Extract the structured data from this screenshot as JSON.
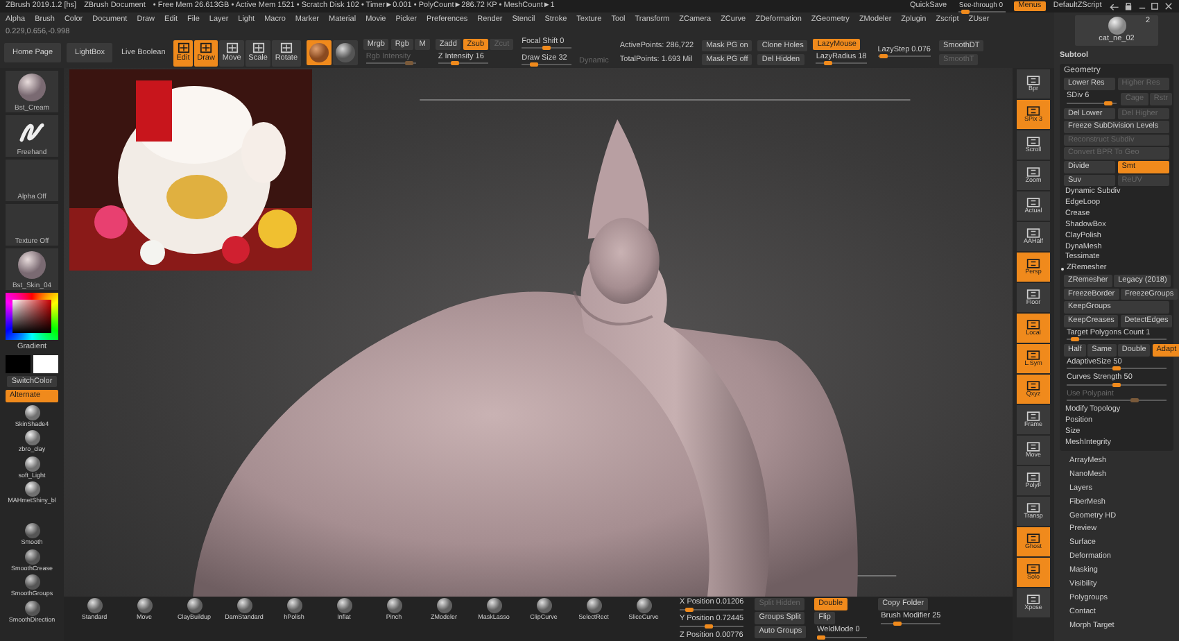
{
  "title_bar": {
    "app": "ZBrush 2019.1.2 [hs]",
    "document": "ZBrush Document",
    "stats": "• Free Mem 26.613GB • Active Mem 1521 • Scratch Disk 102 • Timer►0.001 • PolyCount►286.72 KP • MeshCount►1",
    "items": [
      {
        "kind": "text",
        "label": "QuickSave"
      },
      {
        "kind": "slider",
        "label": "See-through  0",
        "level": 0.05
      },
      {
        "kind": "toggle",
        "label": "Menus",
        "selected": true
      },
      {
        "kind": "text",
        "label": "DefaultZScript"
      }
    ]
  },
  "menu_bar": [
    "Alpha",
    "Brush",
    "Color",
    "Document",
    "Draw",
    "Edit",
    "File",
    "Layer",
    "Light",
    "Macro",
    "Marker",
    "Material",
    "Movie",
    "Picker",
    "Preferences",
    "Render",
    "Stencil",
    "Stroke",
    "Texture",
    "Tool",
    "Transform",
    "ZCamera",
    "ZCurve",
    "ZDeformation",
    "ZGeometry",
    "ZModeler",
    "Zplugin",
    "Zscript",
    "ZUser"
  ],
  "coordinates": "0.229,0.656,-0.998",
  "toolbar": [
    {
      "rows": [
        [
          {
            "kind": "button",
            "label": "Home Page"
          }
        ]
      ]
    },
    {
      "rows": [
        [
          {
            "kind": "button",
            "label": "LightBox"
          }
        ]
      ]
    },
    {
      "rows": [
        [
          {
            "kind": "text",
            "label": "Live Boolean"
          }
        ]
      ]
    },
    {
      "rows": [
        [
          {
            "kind": "icon-button",
            "label": "Edit",
            "selected": true
          },
          {
            "kind": "icon-button",
            "label": "Draw",
            "selected": true
          },
          {
            "kind": "icon-button",
            "label": "Move",
            "selected": false
          },
          {
            "kind": "icon-button",
            "label": "Scale",
            "selected": false
          },
          {
            "kind": "icon-button",
            "label": "Rotate",
            "selected": false
          }
        ]
      ]
    },
    {
      "rows": [
        [
          {
            "kind": "material",
            "selected": true
          },
          {
            "kind": "material",
            "selected": false
          }
        ]
      ]
    },
    {
      "rows": [
        [
          {
            "kind": "toggle",
            "label": "Mrgb",
            "selected": false
          },
          {
            "kind": "toggle",
            "label": "Rgb",
            "selected": false
          },
          {
            "kind": "toggle",
            "label": "M",
            "selected": false
          }
        ],
        [
          {
            "kind": "slider",
            "label": "Rgb Intensity",
            "level": 0.95,
            "disabled": true
          }
        ]
      ]
    },
    {
      "rows": [
        [
          {
            "kind": "toggle",
            "label": "Zadd",
            "selected": false
          },
          {
            "kind": "toggle",
            "label": "Zsub",
            "selected": true
          },
          {
            "kind": "toggle",
            "label": "Zcut",
            "selected": false,
            "disabled": true
          }
        ],
        [
          {
            "kind": "slider",
            "label": "Z Intensity 16",
            "level": 0.3
          }
        ]
      ]
    },
    {
      "rows": [
        [
          {
            "kind": "slider",
            "label": "Focal Shift 0",
            "level": 0.5
          }
        ],
        [
          {
            "kind": "slider",
            "label": "Draw Size 32",
            "level": 0.2
          },
          {
            "kind": "text",
            "label": "Dynamic",
            "disabled": true
          }
        ]
      ]
    },
    {
      "rows": [
        [
          {
            "kind": "text",
            "label": "ActivePoints: 286,722"
          }
        ],
        [
          {
            "kind": "text",
            "label": "TotalPoints: 1.693 Mil"
          }
        ]
      ]
    },
    {
      "rows": [
        [
          {
            "kind": "button",
            "label": "Mask PG on"
          }
        ],
        [
          {
            "kind": "button",
            "label": "Mask PG off"
          }
        ]
      ]
    },
    {
      "rows": [
        [
          {
            "kind": "button",
            "label": "Clone Holes"
          }
        ],
        [
          {
            "kind": "button",
            "label": "Del Hidden"
          }
        ]
      ]
    },
    {
      "rows": [
        [
          {
            "kind": "toggle",
            "label": "LazyMouse",
            "selected": true
          }
        ],
        [
          {
            "kind": "slider",
            "label": "LazyRadius 18",
            "level": 0.2
          }
        ]
      ]
    },
    {
      "rows": [
        [
          {
            "kind": "slider",
            "label": "LazyStep 0.076",
            "level": 0.05
          }
        ]
      ]
    },
    {
      "rows": [
        [
          {
            "kind": "button",
            "label": "SmoothDT"
          }
        ],
        [
          {
            "kind": "button",
            "label": "SmoothT",
            "disabled": true
          }
        ]
      ]
    }
  ],
  "left_shelf": {
    "thumbs": [
      {
        "kind": "sphere",
        "label": "Bst_Cream"
      },
      {
        "kind": "stroke",
        "label": "Freehand"
      },
      {
        "kind": "empty",
        "label": "Alpha Off"
      },
      {
        "kind": "empty",
        "label": "Texture Off"
      },
      {
        "kind": "sphere",
        "label": "Bst_Skin_04"
      }
    ],
    "gradient_label": "Gradient",
    "swatches": [
      {
        "color": "#000000"
      },
      {
        "color": "#ffffff"
      }
    ],
    "switch_color": "SwitchColor",
    "alternate": {
      "label": "Alternate",
      "selected": true
    },
    "materials": [
      "SkinShade4",
      "zbro_clay",
      "soft_Light",
      "MAHmetShiny_bl"
    ],
    "brushes": [
      "Smooth",
      "SmoothCrease",
      "SmoothGroups",
      "SmoothDirection"
    ]
  },
  "right_shelf": [
    {
      "label": "Bpr",
      "selected": false
    },
    {
      "label": "SPix 3",
      "selected": true
    },
    {
      "label": "Scroll",
      "selected": false
    },
    {
      "label": "Zoom",
      "selected": false
    },
    {
      "label": "Actual",
      "selected": false
    },
    {
      "label": "AAHalf",
      "selected": false
    },
    {
      "label": "Persp",
      "selected": true
    },
    {
      "label": "Floor",
      "selected": false
    },
    {
      "label": "Local",
      "selected": true
    },
    {
      "label": "L.Sym",
      "selected": true
    },
    {
      "label": "Qxyz",
      "selected": true
    },
    {
      "label": "Frame",
      "selected": false
    },
    {
      "label": "Move",
      "selected": false
    },
    {
      "label": "PolyF",
      "selected": false
    },
    {
      "label": "Transp",
      "selected": false
    },
    {
      "label": "Ghost",
      "selected": true
    },
    {
      "label": "Solo",
      "selected": true
    },
    {
      "label": "Xpose",
      "selected": false
    }
  ],
  "subtool_palette": {
    "thumb_label": "cat_ne_02",
    "count": "2",
    "title": "Subtool",
    "geometry_title": "Geometry",
    "geometry_rows": [
      [
        {
          "kind": "button",
          "label": "Lower Res"
        },
        {
          "kind": "button",
          "label": "Higher Res",
          "disabled": true
        }
      ],
      [
        {
          "kind": "slider",
          "label": "SDiv 6",
          "level": 0.9
        },
        {
          "kind": "button",
          "label": "Cage",
          "disabled": true
        },
        {
          "kind": "button",
          "label": "Rstr",
          "disabled": true
        }
      ],
      [
        {
          "kind": "button",
          "label": "Del Lower"
        },
        {
          "kind": "button",
          "label": "Del Higher",
          "disabled": true
        }
      ],
      [
        {
          "kind": "button",
          "label": "Freeze SubDivision Levels"
        }
      ],
      [
        {
          "kind": "button",
          "label": "Reconstruct Subdiv",
          "disabled": true
        }
      ],
      [
        {
          "kind": "button",
          "label": "Convert BPR To Geo",
          "disabled": true
        }
      ],
      [
        {
          "kind": "button",
          "label": "Divide"
        },
        {
          "kind": "toggle",
          "label": "Smt",
          "selected": true
        }
      ],
      [
        {
          "kind": "toggle",
          "label": "Suv",
          "selected": false
        },
        {
          "kind": "toggle",
          "label": "ReUV",
          "selected": false,
          "disabled": true
        }
      ],
      [
        {
          "kind": "section",
          "label": "Dynamic Subdiv",
          "expanded": false
        }
      ],
      [
        {
          "kind": "section",
          "label": "EdgeLoop",
          "expanded": false
        }
      ],
      [
        {
          "kind": "section",
          "label": "Crease",
          "expanded": false
        }
      ],
      [
        {
          "kind": "section",
          "label": "ShadowBox",
          "expanded": false
        }
      ],
      [
        {
          "kind": "section",
          "label": "ClayPolish",
          "expanded": false
        }
      ],
      [
        {
          "kind": "section",
          "label": "DynaMesh",
          "expanded": false
        }
      ],
      [
        {
          "kind": "section",
          "label": "Tessimate",
          "expanded": false
        }
      ],
      [
        {
          "kind": "section",
          "label": "ZRemesher",
          "expanded": true
        }
      ],
      [
        {
          "kind": "button",
          "label": "ZRemesher"
        },
        {
          "kind": "button",
          "label": "Legacy (2018)"
        }
      ],
      [
        {
          "kind": "toggle",
          "label": "FreezeBorder",
          "selected": false
        },
        {
          "kind": "toggle",
          "label": "FreezeGroups",
          "selected": false
        }
      ],
      [
        {
          "kind": "toggle",
          "label": "KeepGroups",
          "selected": false
        }
      ],
      [
        {
          "kind": "toggle",
          "label": "KeepCreases",
          "selected": false
        },
        {
          "kind": "toggle",
          "label": "DetectEdges",
          "selected": false
        }
      ],
      [
        {
          "kind": "slider",
          "label": "Target Polygons Count 1",
          "level": 0.05
        }
      ],
      [
        {
          "kind": "toggle",
          "label": "Half",
          "selected": false
        },
        {
          "kind": "toggle",
          "label": "Same",
          "selected": false
        },
        {
          "kind": "toggle",
          "label": "Double",
          "selected": false
        },
        {
          "kind": "toggle",
          "label": "Adapt",
          "selected": true
        }
      ],
      [
        {
          "kind": "slider",
          "label": "AdaptiveSize 50",
          "level": 0.5
        }
      ],
      [
        {
          "kind": "slider",
          "label": "Curves Strength 50",
          "level": 0.5
        }
      ],
      [
        {
          "kind": "slider",
          "label": "Use Polypaint",
          "level": 0.7,
          "disabled": true
        }
      ],
      [
        {
          "kind": "section",
          "label": "Modify Topology",
          "expanded": false
        }
      ],
      [
        {
          "kind": "section",
          "label": "Position",
          "expanded": false
        }
      ],
      [
        {
          "kind": "section",
          "label": "Size",
          "expanded": false
        }
      ],
      [
        {
          "kind": "section",
          "label": "MeshIntegrity",
          "expanded": false
        }
      ]
    ],
    "sections": [
      "ArrayMesh",
      "NanoMesh",
      "Layers",
      "FiberMesh",
      "Geometry HD",
      "Preview",
      "Surface",
      "Deformation",
      "Masking",
      "Visibility",
      "Polygroups",
      "Contact",
      "Morph Target"
    ]
  },
  "bottom_bar": {
    "brushes": [
      "Standard",
      "Move",
      "ClayBuildup",
      "DamStandard",
      "hPolish",
      "Inflat",
      "Pinch",
      "ZModeler",
      "MaskLasso",
      "ClipCurve",
      "SelectRect",
      "SliceCurve"
    ],
    "columns": [
      {
        "rows": [
          [
            {
              "kind": "slider",
              "label": "X Position  0.01206",
              "level": 0.1
            }
          ],
          [
            {
              "kind": "slider",
              "label": "Y Position  0.72445",
              "level": 0.45
            }
          ],
          [
            {
              "kind": "slider",
              "label": "Z Position  0.00776",
              "level": 0.12
            }
          ]
        ]
      },
      {
        "rows": [
          [
            {
              "kind": "button",
              "label": "Split Hidden",
              "disabled": true
            }
          ],
          [
            {
              "kind": "button",
              "label": "Groups Split"
            }
          ],
          [
            {
              "kind": "button",
              "label": "Auto Groups"
            }
          ]
        ]
      },
      {
        "rows": [
          [
            {
              "kind": "toggle",
              "label": "Double",
              "selected": true
            }
          ],
          [
            {
              "kind": "toggle",
              "label": "Flip",
              "selected": false
            }
          ],
          [
            {
              "kind": "slider",
              "label": "WeldMode 0",
              "level": 0.0
            }
          ]
        ]
      },
      {
        "rows": [
          [
            {
              "kind": "button",
              "label": "Copy Folder"
            }
          ],
          [
            {
              "kind": "slider",
              "label": "Brush Modifier 25",
              "level": 0.25
            }
          ]
        ]
      }
    ]
  }
}
